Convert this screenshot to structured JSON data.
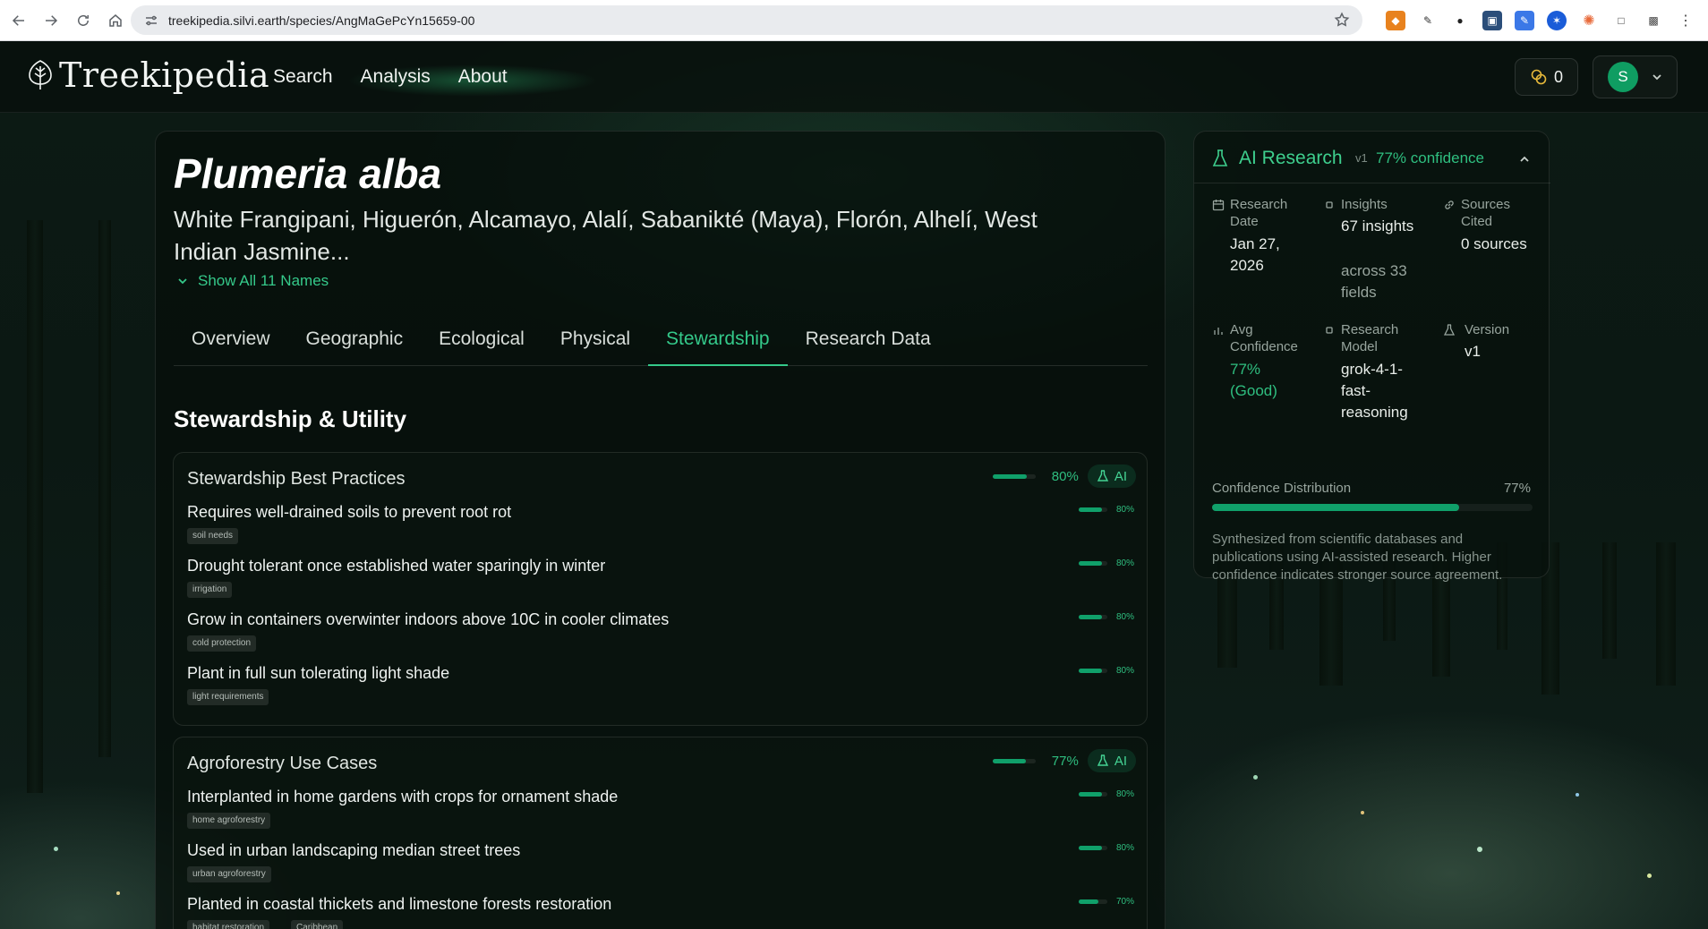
{
  "browser": {
    "url": "treekipedia.silvi.earth/species/AngMaGePcYn15659-00"
  },
  "header": {
    "logo_text": "Treekipedia",
    "nav": [
      "Search",
      "Analysis",
      "About"
    ],
    "credits": "0",
    "avatar_initial": "S"
  },
  "species": {
    "scientific_name": "Plumeria alba",
    "common_names": "White Frangipani, Higuerón, Alcamayo, Alalí, Sabanikté (Maya), Florón, Alhelí, West Indian Jasmine...",
    "show_all": "Show All 11 Names"
  },
  "tabs": [
    "Overview",
    "Geographic",
    "Ecological",
    "Physical",
    "Stewardship",
    "Research Data"
  ],
  "active_tab": "Stewardship",
  "section_title": "Stewardship & Utility",
  "ai_badge": "AI",
  "blocks": [
    {
      "title": "Stewardship Best Practices",
      "confidence": 0.8,
      "confidence_label": "80%",
      "items": [
        {
          "text": "Requires well-drained soils to prevent root rot",
          "tags": [
            "soil needs"
          ],
          "confidence": 0.8,
          "confidence_label": "80%"
        },
        {
          "text": "Drought tolerant once established water sparingly in winter",
          "tags": [
            "irrigation"
          ],
          "confidence": 0.8,
          "confidence_label": "80%"
        },
        {
          "text": "Grow in containers overwinter indoors above 10C in cooler climates",
          "tags": [
            "cold protection"
          ],
          "confidence": 0.8,
          "confidence_label": "80%"
        },
        {
          "text": "Plant in full sun tolerating light shade",
          "tags": [
            "light requirements"
          ],
          "confidence": 0.8,
          "confidence_label": "80%"
        }
      ]
    },
    {
      "title": "Agroforestry Use Cases",
      "confidence": 0.77,
      "confidence_label": "77%",
      "items": [
        {
          "text": "Interplanted in home gardens with crops for ornament shade",
          "tags": [
            "home agroforestry"
          ],
          "confidence": 0.8,
          "confidence_label": "80%"
        },
        {
          "text": "Used in urban landscaping median street trees",
          "tags": [
            "urban agroforestry"
          ],
          "confidence": 0.8,
          "confidence_label": "80%"
        },
        {
          "text": "Planted in coastal thickets and limestone forests restoration",
          "tags": [
            "habitat restoration",
            "Caribbean"
          ],
          "confidence": 0.7,
          "confidence_label": "70%"
        }
      ]
    }
  ],
  "research": {
    "title": "AI Research",
    "version_tag": "v1",
    "confidence_text": "77% confidence",
    "research_date_label": "Research Date",
    "research_date": "Jan 27, 2026",
    "insights_label": "Insights",
    "insights_value": "67 insights",
    "insights_sub": "across 33 fields",
    "sources_label": "Sources Cited",
    "sources_value": "0 sources",
    "avg_conf_label": "Avg Confidence",
    "avg_conf_value": "77% (Good)",
    "model_label": "Research Model",
    "model_value": "grok-4-1-fast-reasoning",
    "version_label": "Version",
    "version_value": "v1",
    "distribution_label": "Confidence Distribution",
    "distribution_pct": "77%",
    "distribution_value": 0.77,
    "note": "Synthesized from scientific databases and publications using AI-assisted research. Higher confidence indicates stronger source agreement."
  },
  "colors": {
    "accent": "#34c98a",
    "bar": "#10a06a",
    "background": "#0b130f"
  }
}
